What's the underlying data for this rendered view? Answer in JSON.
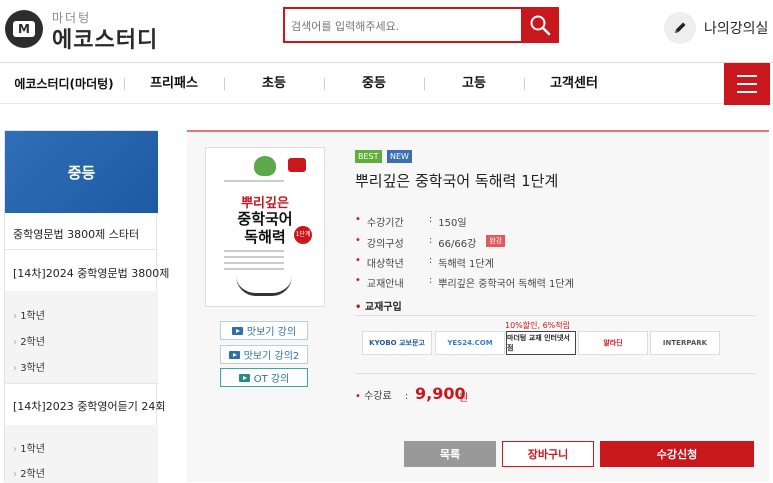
{
  "header": {
    "logo_circle_text": "M",
    "logo_sub": "마더텅",
    "logo_main": "에코스터디",
    "search_placeholder": "검색어를 입력해주세요.",
    "my_lecture_label": "나의강의실",
    "icons": [
      "search-icon",
      "pencil-icon",
      "menu-icon"
    ],
    "accent_color": "#c9171e"
  },
  "nav": {
    "items": [
      "에코스터디(마더텅)",
      "프리패스",
      "초등",
      "중등",
      "고등",
      "고객센터"
    ]
  },
  "sidebar": {
    "title": "중등",
    "links": [
      "중학영문법 3800제 스타터",
      "[14차]2024 중학영문법 3800제",
      "1학년",
      "2학년",
      "3학년",
      "[14차]2023 중학영어듣기 24회",
      "1학년",
      "2학년"
    ]
  },
  "product": {
    "badges": [
      "BEST",
      "NEW"
    ],
    "title": "뿌리깊은 중학국어 독해력 1단계",
    "book_cover": {
      "title_line1": "뿌리깊은",
      "title_line2": "중학국어",
      "title_line3": "독해력",
      "badge": "1단계"
    },
    "lecture_buttons": [
      "맛보기 강의",
      "맛보기 강의2",
      "OT 강의"
    ],
    "info": [
      {
        "label": "수강기간",
        "value": "150일"
      },
      {
        "label": "강의구성",
        "value": "66/66강",
        "tag": "완강"
      },
      {
        "label": "대상학년",
        "value": "독해력 1단계"
      },
      {
        "label": "교재안내",
        "value": "뿌리깊은 중학국어 독해력 1단계"
      }
    ],
    "buy_title": "교재구입",
    "discount_note": "10%할인, 6%적립",
    "stores": [
      "KYOBO 교보문고",
      "YES24.COM",
      "마더텅 교재 인터넷서점",
      "알라딘",
      "INTERPARK"
    ],
    "price_label": "수강료",
    "price_value": "9,900",
    "price_unit": "원",
    "buttons": {
      "list": "목록",
      "cart": "장바구니",
      "enroll": "수강신청"
    }
  }
}
